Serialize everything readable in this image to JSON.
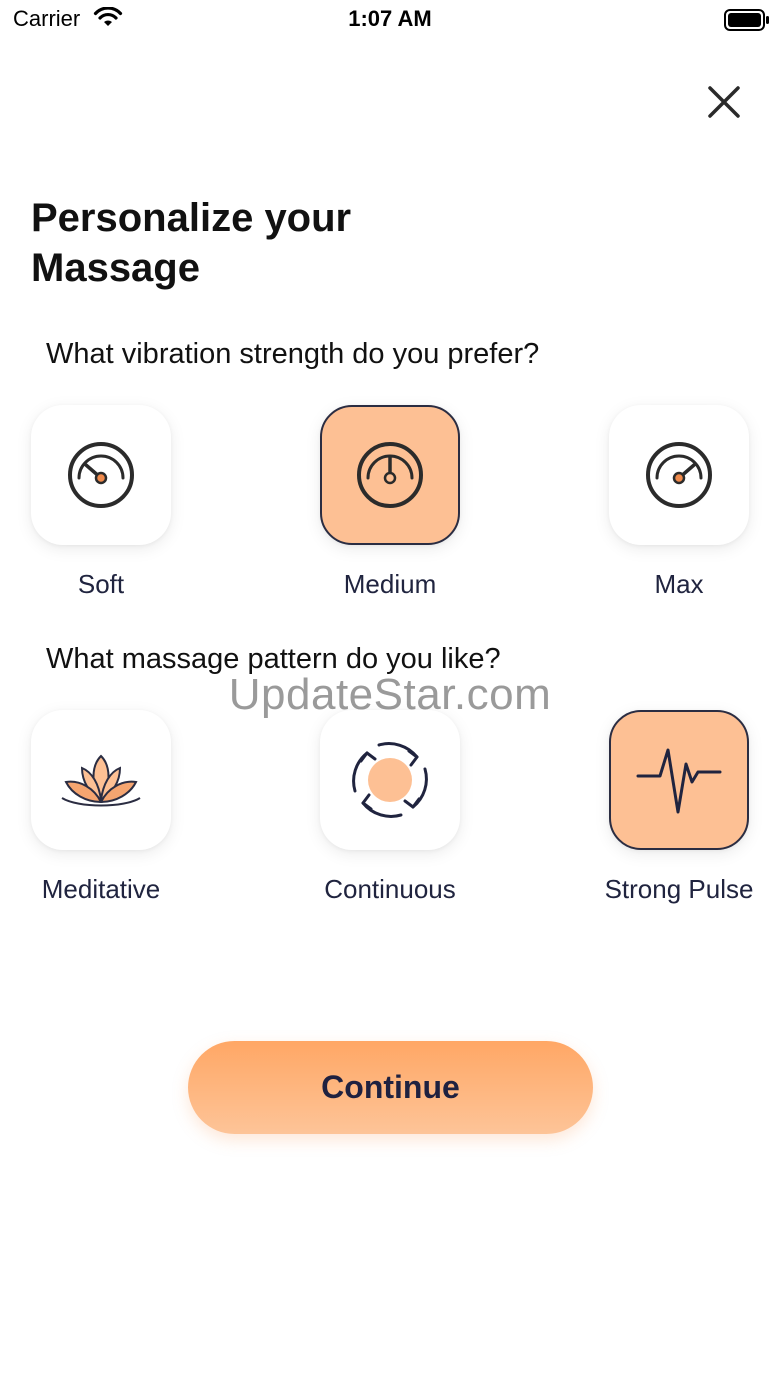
{
  "status_bar": {
    "carrier": "Carrier",
    "time": "1:07 AM"
  },
  "page": {
    "title": "Personalize your Massage"
  },
  "strength": {
    "question": "What vibration strength do you prefer?",
    "options": [
      {
        "label": "Soft",
        "icon": "gauge-low-icon",
        "selected": false
      },
      {
        "label": "Medium",
        "icon": "gauge-medium-icon",
        "selected": true
      },
      {
        "label": "Max",
        "icon": "gauge-high-icon",
        "selected": false
      }
    ]
  },
  "pattern": {
    "question": "What massage pattern do you like?",
    "options": [
      {
        "label": "Meditative",
        "icon": "lotus-icon",
        "selected": false
      },
      {
        "label": "Continuous",
        "icon": "cycle-icon",
        "selected": false
      },
      {
        "label": "Strong Pulse",
        "icon": "pulse-icon",
        "selected": true
      }
    ]
  },
  "watermark": "UpdateStar.com",
  "continue_label": "Continue",
  "colors": {
    "accent": "#fdc094",
    "accent_dark": "#ffa765",
    "text_dark": "#20243f",
    "icon_dot": "#f08a4b"
  }
}
